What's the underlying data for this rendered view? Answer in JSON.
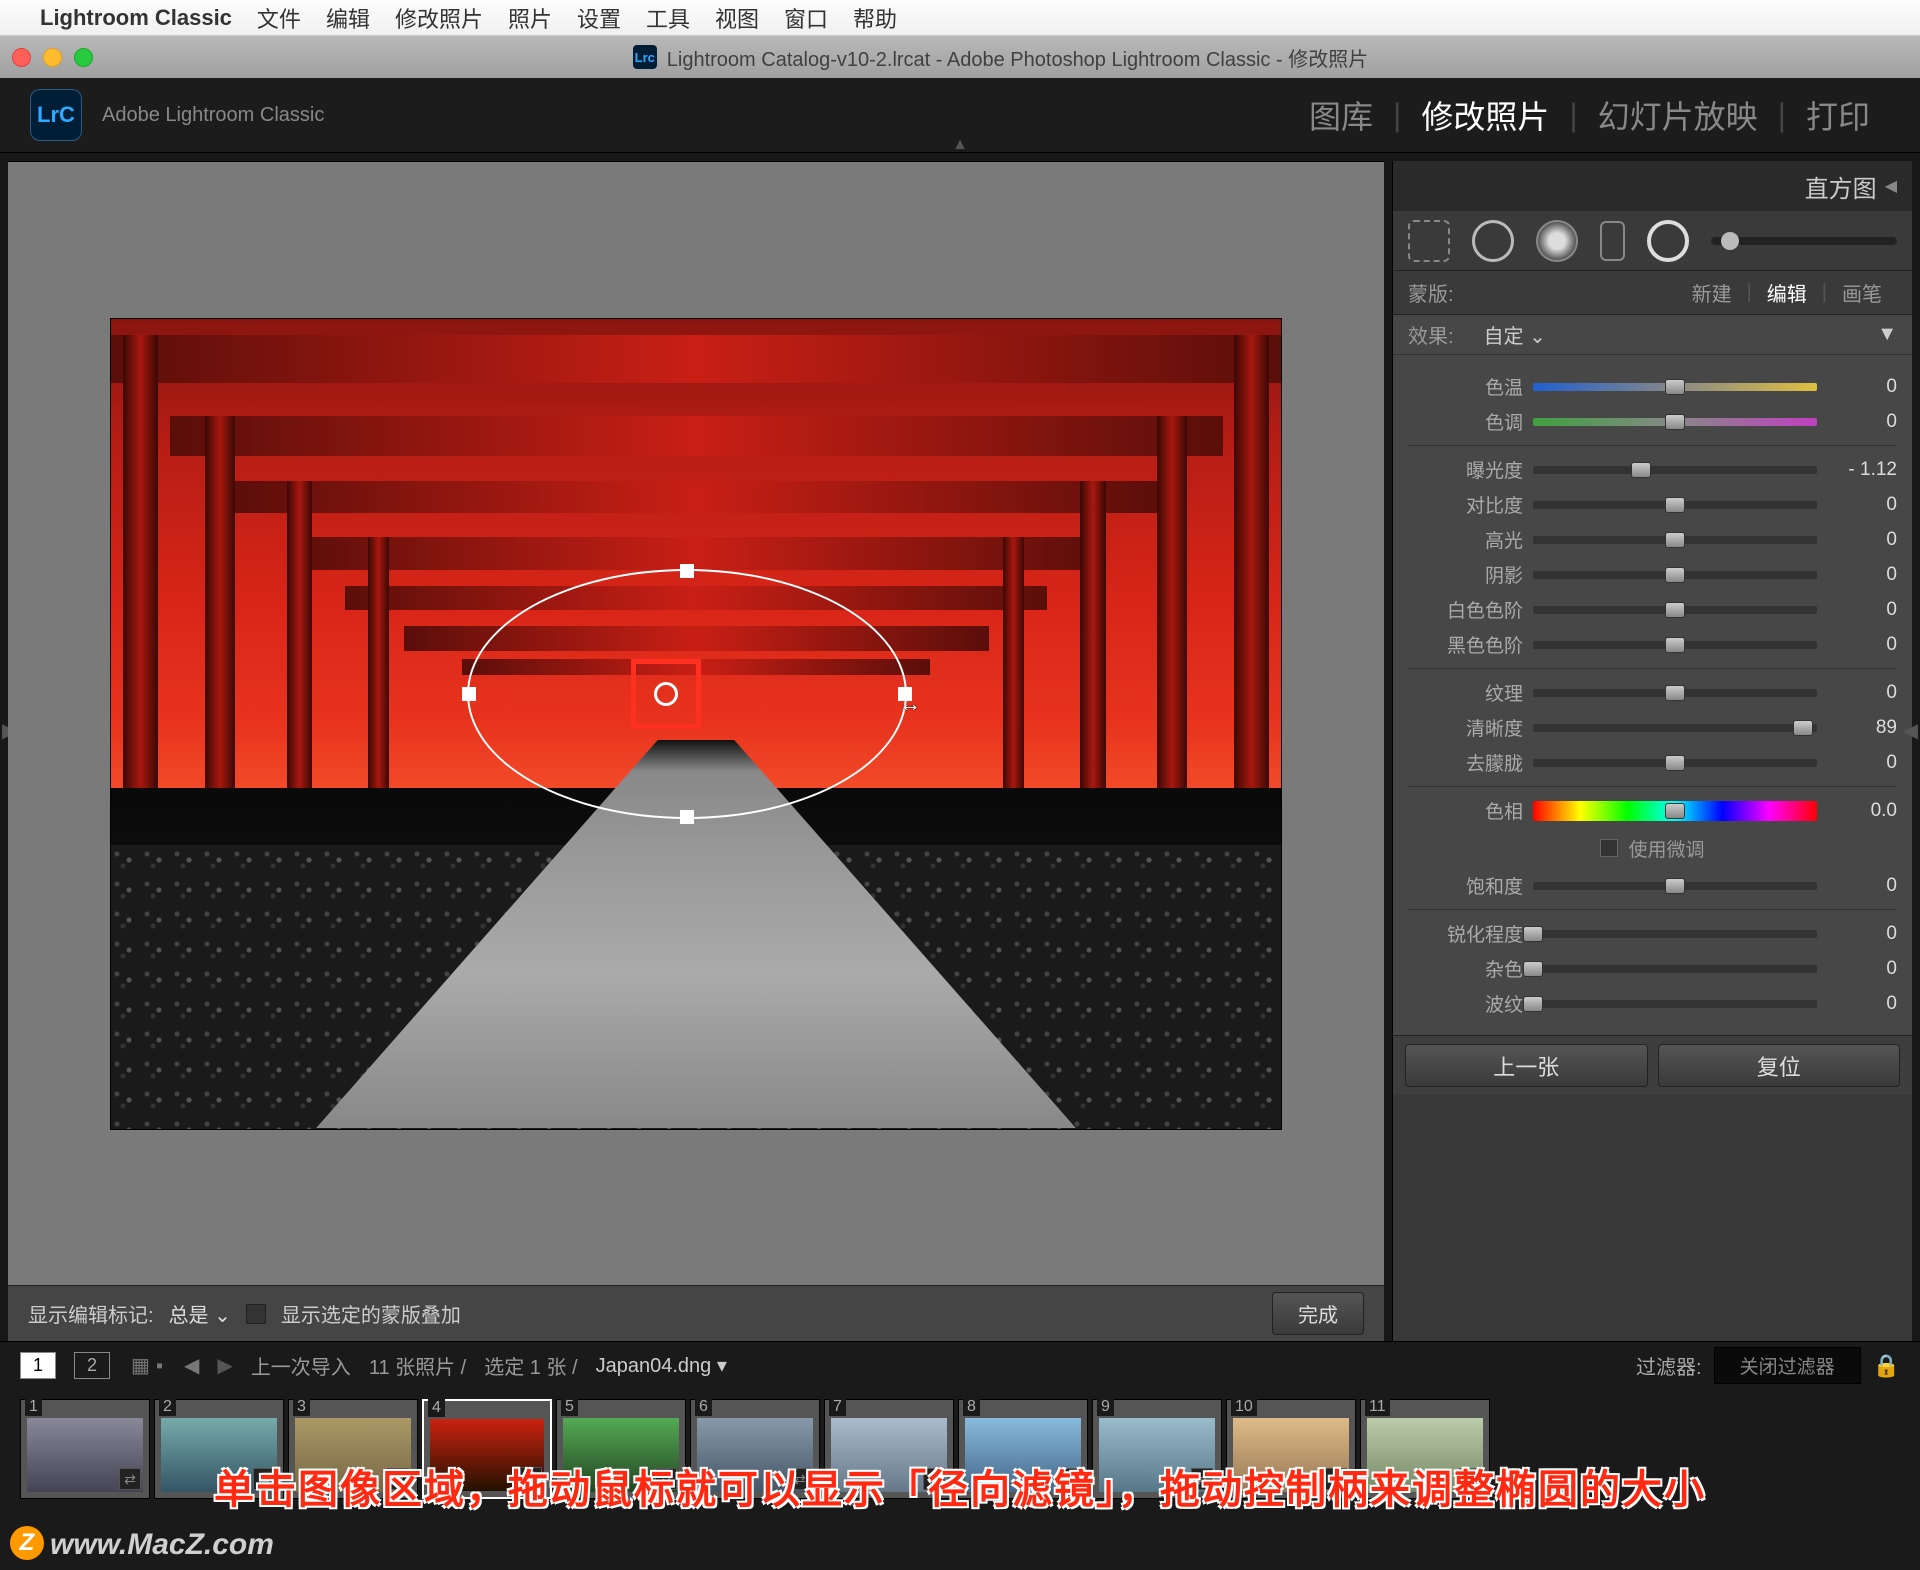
{
  "menubar": {
    "app": "Lightroom Classic",
    "items": [
      "文件",
      "编辑",
      "修改照片",
      "照片",
      "设置",
      "工具",
      "视图",
      "窗口",
      "帮助"
    ]
  },
  "window_title": "Lightroom Catalog-v10-2.lrcat - Adobe Photoshop Lightroom Classic - 修改照片",
  "logo_text": "LrC",
  "app_subname": "Adobe Lightroom Classic",
  "modules": {
    "library": "图库",
    "develop": "修改照片",
    "slideshow": "幻灯片放映",
    "print": "打印"
  },
  "panel": {
    "histogram": "直方图",
    "mask_label": "蒙版:",
    "mask_tabs": {
      "new": "新建",
      "edit": "编辑",
      "brush": "画笔"
    },
    "effect_label": "效果:",
    "effect_value": "自定",
    "sliders": {
      "temp": {
        "label": "色温",
        "value": "0",
        "pos": 50
      },
      "tint": {
        "label": "色调",
        "value": "0",
        "pos": 50
      },
      "exposure": {
        "label": "曝光度",
        "value": "- 1.12",
        "pos": 38
      },
      "contrast": {
        "label": "对比度",
        "value": "0",
        "pos": 50
      },
      "highlights": {
        "label": "高光",
        "value": "0",
        "pos": 50
      },
      "shadows": {
        "label": "阴影",
        "value": "0",
        "pos": 50
      },
      "whites": {
        "label": "白色色阶",
        "value": "0",
        "pos": 50
      },
      "blacks": {
        "label": "黑色色阶",
        "value": "0",
        "pos": 50
      },
      "texture": {
        "label": "纹理",
        "value": "0",
        "pos": 50
      },
      "clarity": {
        "label": "清晰度",
        "value": "89",
        "pos": 95
      },
      "dehaze": {
        "label": "去朦胧",
        "value": "0",
        "pos": 50
      },
      "hue": {
        "label": "色相",
        "value": "0.0",
        "pos": 50
      },
      "saturation": {
        "label": "饱和度",
        "value": "0",
        "pos": 50
      },
      "sharpness": {
        "label": "锐化程度",
        "value": "0",
        "pos": 0
      },
      "noise": {
        "label": "杂色",
        "value": "0",
        "pos": 0
      },
      "moire": {
        "label": "波纹",
        "value": "0",
        "pos": 0
      }
    },
    "use_fine": "使用微调",
    "prev": "上一张",
    "reset": "复位"
  },
  "viewer_bar": {
    "show_edit_label": "显示编辑标记:",
    "always": "总是",
    "show_overlay": "显示选定的蒙版叠加",
    "done": "完成"
  },
  "filmstrip_header": {
    "last_import": "上一次导入",
    "count": "11 张照片 /",
    "selected": "选定 1 张 /",
    "filename": "Japan04.dng",
    "filter_label": "过滤器:",
    "filter_value": "关闭过滤器"
  },
  "thumbs": [
    "1",
    "2",
    "3",
    "4",
    "5",
    "6",
    "7",
    "8",
    "9",
    "10",
    "11"
  ],
  "annotation": "单击图像区域，拖动鼠标就可以显示「径向滤镜」，拖动控制柄来调整椭圆的大小",
  "watermark": "www.MacZ.com",
  "wm_badge": "Z"
}
